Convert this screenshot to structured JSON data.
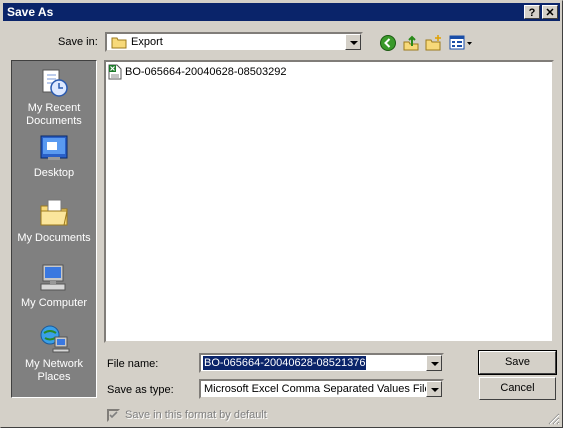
{
  "window": {
    "title": "Save As",
    "help_glyph": "?",
    "close_glyph": "✕"
  },
  "toolbar": {
    "save_in_label": "Save in:",
    "save_in_value": "Export",
    "icons": [
      "back-icon",
      "up-folder-icon",
      "new-folder-icon",
      "view-menu-icon"
    ]
  },
  "places": [
    {
      "label": "My Recent\nDocuments",
      "icon": "recent-documents-icon"
    },
    {
      "label": "Desktop",
      "icon": "desktop-icon"
    },
    {
      "label": "My Documents",
      "icon": "my-documents-icon"
    },
    {
      "label": "My Computer",
      "icon": "my-computer-icon"
    },
    {
      "label": "My Network\nPlaces",
      "icon": "network-places-icon"
    }
  ],
  "files": [
    {
      "name": "BO-065664-20040628-08503292",
      "icon": "excel-csv-file-icon"
    }
  ],
  "form": {
    "file_name_label": "File name:",
    "file_name_value": "BO-065664-20040628-08521376",
    "save_as_type_label": "Save as type:",
    "save_as_type_value": "Microsoft Excel Comma Separated Values File",
    "default_checkbox_label": "Save in this format by default",
    "default_checkbox_checked": true
  },
  "buttons": {
    "save": "Save",
    "cancel": "Cancel"
  },
  "colors": {
    "titlebar": "#0a246a",
    "selection": "#0a246a",
    "face": "#d4d0c8",
    "places_bg": "#808080"
  }
}
